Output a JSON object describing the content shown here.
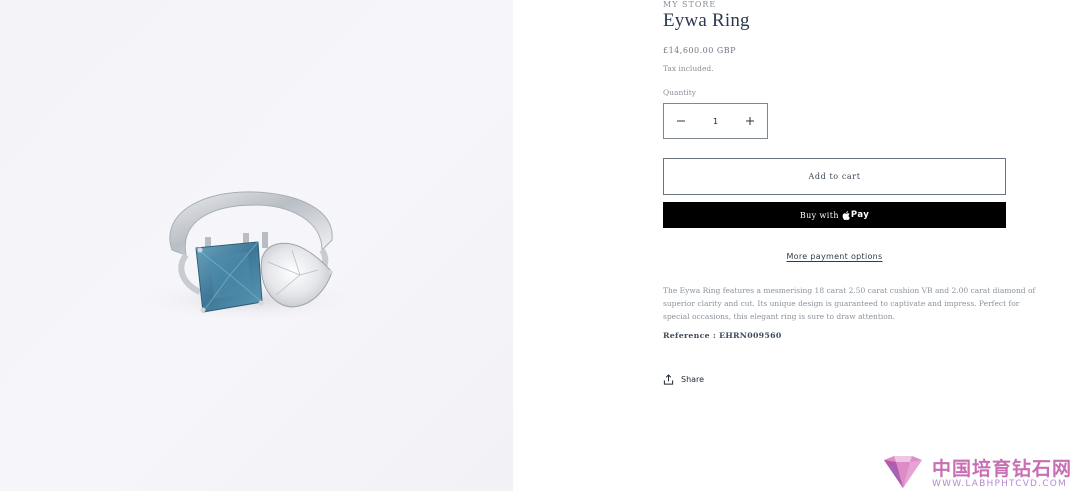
{
  "product": {
    "vendor": "MY STORE",
    "title": "Eywa Ring",
    "price": "£14,600.00 GBP",
    "tax_note": "Tax included.",
    "quantity_label": "Quantity",
    "quantity_value": "1",
    "add_to_cart_label": "Add to cart",
    "buy_with_label": "Buy with",
    "buy_pay_label": "Pay",
    "more_payment_label": "More payment options",
    "description": "The Eywa Ring features a mesmerising 18 carat 2.50 carat cushion VB and 2.00 carat diamond of superior clarity and cut. Its unique design is guaranteed to captivate and impress. Perfect for special occasions, this elegant ring is sure to draw attention.",
    "reference": "Reference : EHRN009560",
    "share_label": "Share"
  },
  "icons": {
    "minus": "minus-icon",
    "plus": "plus-icon",
    "apple": "apple-icon",
    "share": "share-icon"
  },
  "watermark": {
    "cn_text": "中国培育钻石网",
    "en_text": "WWW.LABHPHTCVD.COM"
  },
  "colors": {
    "buy_button_bg": "#000000",
    "blue_stone": "#4a86a6",
    "watermark_pink": "#c86fb3"
  }
}
